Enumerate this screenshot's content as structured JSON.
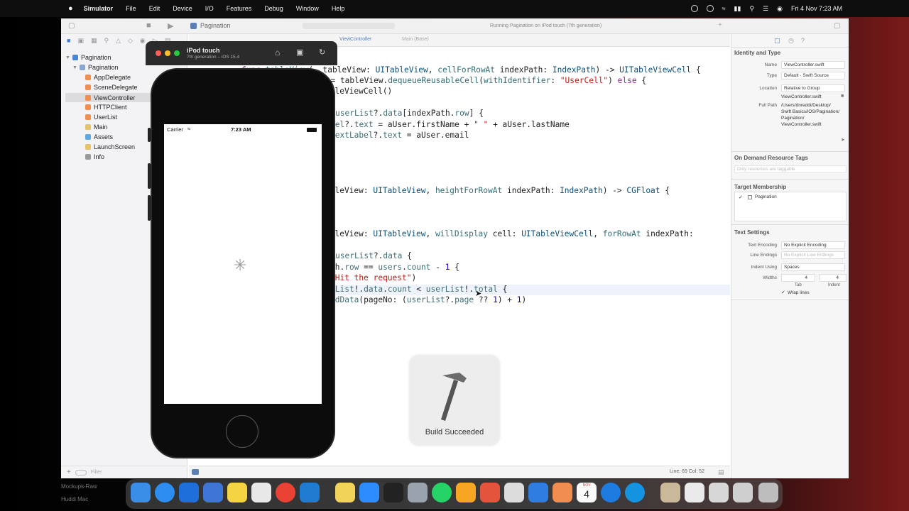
{
  "menubar": {
    "app": "Simulator",
    "items": [
      "File",
      "Edit",
      "Device",
      "I/O",
      "Features",
      "Debug",
      "Window",
      "Help"
    ],
    "datetime": "Fri 4 Nov  7:23 AM"
  },
  "xcode": {
    "scheme": "Pagination",
    "status": "Running Pagination on iPod touch (7th generation)",
    "tabs": [
      "ViewController",
      "Main (Base)"
    ],
    "navigator": {
      "items": [
        {
          "label": "Pagination",
          "level": 0
        },
        {
          "label": "Pagination",
          "level": 1
        },
        {
          "label": "AppDelegate",
          "level": 2
        },
        {
          "label": "SceneDelegate",
          "level": 2
        },
        {
          "label": "ViewController",
          "level": 2
        },
        {
          "label": "HTTPClient",
          "level": 2
        },
        {
          "label": "UserList",
          "level": 2
        },
        {
          "label": "Main",
          "level": 2
        },
        {
          "label": "Assets",
          "level": 2
        },
        {
          "label": "LaunchScreen",
          "level": 2
        },
        {
          "label": "Info",
          "level": 2
        }
      ],
      "filter_placeholder": "Filter"
    },
    "editor_footer": "Line: 69  Col: 52",
    "code": [
      "func tableView(_ tableView: UITableView, cellForRowAt indexPath: IndexPath) -> UITableViewCell {",
      "l = tableView.dequeueReusableCell(withIdentifier: \"UserCell\") else {",
      "ableViewCell()",
      "userList?.data[indexPath.row] {",
      "bel?.text = aUser.firstName + \" \" + aUser.lastName",
      "TextLabel?.text = aUser.email",
      "ableView: UITableView, heightForRowAt indexPath: IndexPath) -> CGFloat {",
      "ableView: UITableView, willDisplay cell: UITableViewCell, forRowAt indexPath:",
      "userList?.data {",
      "th.row == users.count - 1 {",
      "\"Hit the request\")",
      "rList!.data.count < userList!.total {",
      "adData(pageNo: (userList?.page ?? 1) + 1)"
    ]
  },
  "inspector": {
    "identity_title": "Identity and Type",
    "name_label": "Name",
    "name_value": "ViewController.swift",
    "type_label": "Type",
    "type_value": "Default - Swift Source",
    "location_label": "Location",
    "location_value": "Relative to Group",
    "location_file": "ViewController.swift",
    "fullpath_label": "Full Path",
    "fullpath_value": "/Users/dnreddi/Desktop/ Swift Basics/iOS/Pagination/ Pagination/ ViewController.swift",
    "odr_title": "On Demand Resource Tags",
    "odr_placeholder": "Only resources are taggable",
    "target_title": "Target Membership",
    "target_item": "Pagination",
    "text_title": "Text Settings",
    "encoding_label": "Text Encoding",
    "encoding_value": "No Explicit Encoding",
    "endings_label": "Line Endings",
    "endings_value": "No Explicit Line Endings",
    "indent_label": "Indent Using",
    "indent_value": "Spaces",
    "widths_label": "Widths",
    "tab_value": "4",
    "indent_width_value": "4",
    "tab_label": "Tab",
    "indent_sub_label": "Indent",
    "wrap_label": "Wrap lines"
  },
  "simulator": {
    "device": "iPod touch",
    "subtitle": "7th generation – iOS 15.4",
    "carrier": "Carrier",
    "time": "7:23 AM"
  },
  "hud": {
    "text": "Build Succeeded"
  },
  "dock": {
    "calendar_month": "NOV",
    "calendar_day": "4"
  },
  "desktop": {
    "label1": "Mockups-Raw",
    "label2": "Huddi Mac"
  }
}
